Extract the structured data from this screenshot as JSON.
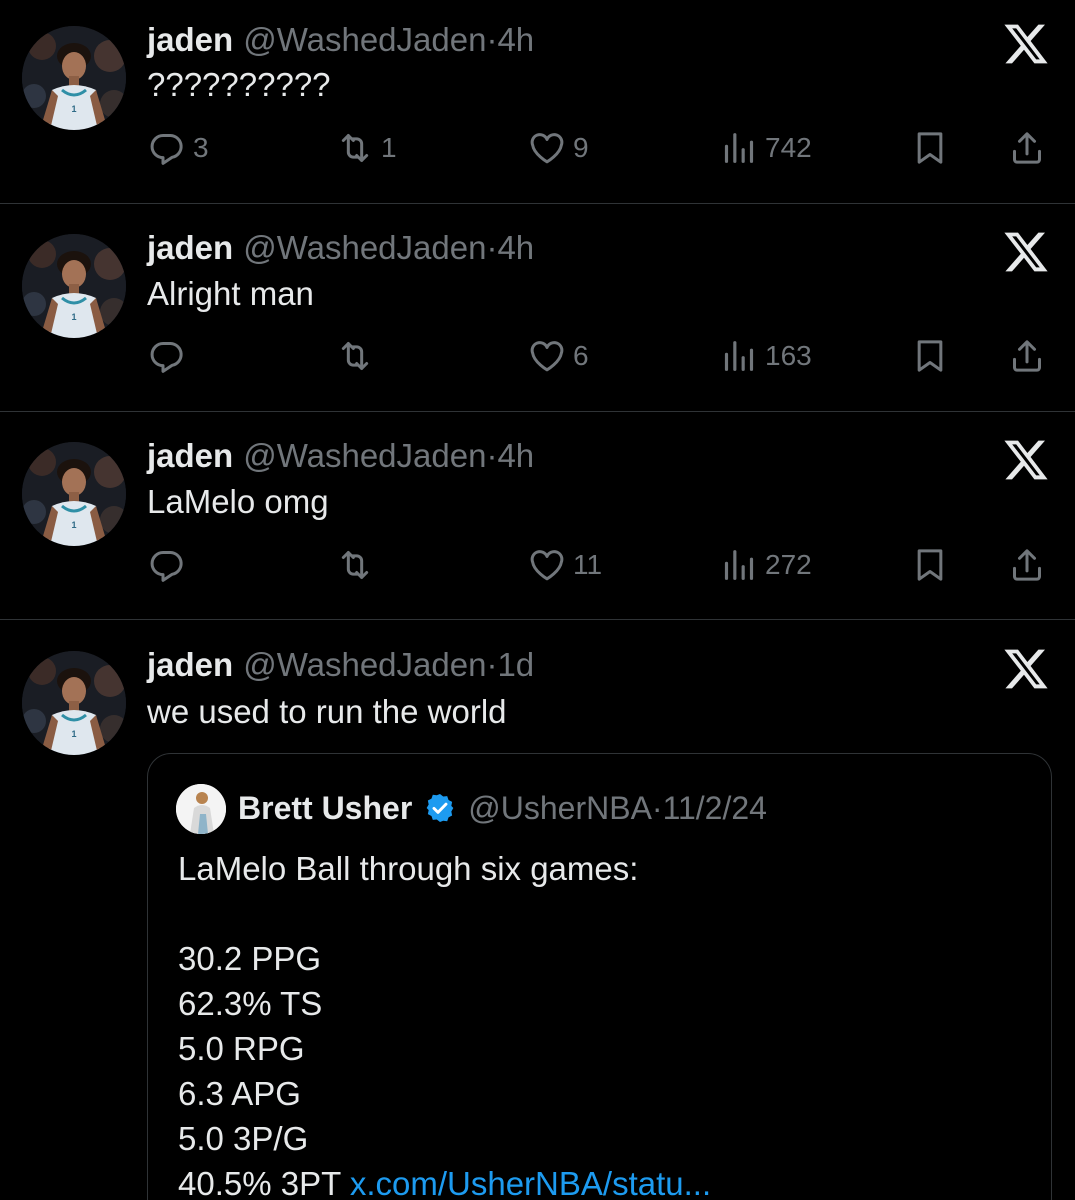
{
  "tweets": [
    {
      "name": "jaden",
      "handle": "@WashedJaden",
      "dot": "·",
      "time": "4h",
      "text": "??????????",
      "reply_count": "3",
      "retweet_count": "1",
      "like_count": "9",
      "view_count": "742"
    },
    {
      "name": "jaden",
      "handle": "@WashedJaden",
      "dot": "·",
      "time": "4h",
      "text": "Alright man",
      "reply_count": "",
      "retweet_count": "",
      "like_count": "6",
      "view_count": "163"
    },
    {
      "name": "jaden",
      "handle": "@WashedJaden",
      "dot": "·",
      "time": "4h",
      "text": "LaMelo omg",
      "reply_count": "",
      "retweet_count": "",
      "like_count": "11",
      "view_count": "272"
    },
    {
      "name": "jaden",
      "handle": "@WashedJaden",
      "dot": "·",
      "time": "1d",
      "text": "we used to run the world"
    }
  ],
  "quote": {
    "name": "Brett Usher",
    "handle": "@UsherNBA",
    "dot": "·",
    "date": "11/2/24",
    "intro": "LaMelo Ball through six games:",
    "stats": [
      "30.2 PPG",
      "62.3% TS",
      "5.0 RPG",
      "6.3 APG",
      "5.0 3P/G",
      "40.5% 3PT"
    ],
    "link": "x.com/UsherNBA/statu..."
  },
  "icons": {
    "reply": "reply-icon",
    "retweet": "retweet-icon",
    "like": "like-icon",
    "views": "views-icon",
    "bookmark": "bookmark-icon",
    "share": "share-icon",
    "close": "x-logo-icon",
    "verified": "verified-badge-icon"
  },
  "colors": {
    "background": "#000000",
    "text": "#e7e9ea",
    "muted": "#71767b",
    "link": "#1d9bf0",
    "divider": "#2f3336"
  }
}
